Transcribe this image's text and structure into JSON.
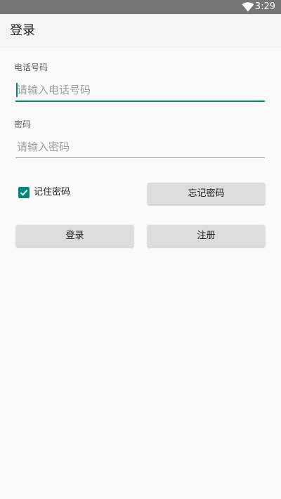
{
  "status_bar": {
    "time": "3:29",
    "wifi_icon": "wifi-icon",
    "background": "#757575"
  },
  "app_bar": {
    "title": "登录"
  },
  "form": {
    "phone": {
      "label": "电话号码",
      "placeholder": "请输入电话号码",
      "value": ""
    },
    "password": {
      "label": "密码",
      "placeholder": "请输入密码",
      "value": ""
    },
    "remember": {
      "label": "记住密码",
      "checked": true
    },
    "forgot_label": "忘记密码",
    "login_label": "登录",
    "register_label": "注册"
  },
  "colors": {
    "accent": "#00897b",
    "button": "#dcdcdc",
    "background": "#fafafa"
  }
}
